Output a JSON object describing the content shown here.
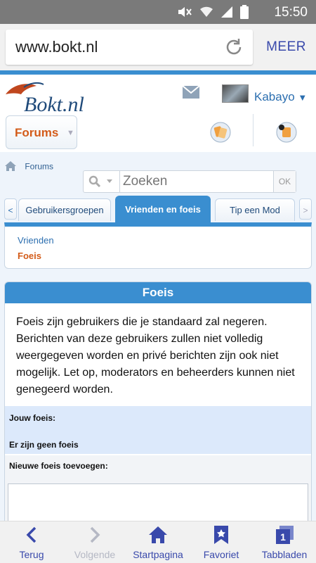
{
  "status_bar": {
    "time": "15:50"
  },
  "browser": {
    "url": "www.bokt.nl",
    "menu_label": "MEER"
  },
  "site": {
    "logo_text": "Bokt.nl",
    "user": {
      "name": "Kabayo",
      "caret": "▼"
    },
    "forums_button": {
      "label": "Forums",
      "caret": "▼"
    },
    "breadcrumb": {
      "label": "Forums"
    },
    "search": {
      "placeholder": "Zoeken",
      "submit": "OK"
    },
    "tabs": {
      "prev": "<",
      "next": ">",
      "items": [
        {
          "label": "Gebruikersgroepen",
          "active": false
        },
        {
          "label": "Vrienden en foeis",
          "active": true
        },
        {
          "label": "Tip een Mod",
          "active": false
        }
      ]
    },
    "sub_nav": {
      "friends": "Vrienden",
      "foes": "Foeis"
    },
    "panel": {
      "title": "Foeis",
      "description": "Foeis zijn gebruikers die je standaard zal negeren. Berichten van deze gebruikers zullen niet volledig weergegeven worden en privé berichten zijn ook niet mogelijk. Let op, moderators en beheerders kunnen niet genegeerd worden.",
      "your_foes_label": "Jouw foeis:",
      "no_foes_text": "Er zijn geen foeis",
      "add_foes_label": "Nieuwe foeis toevoegen:"
    }
  },
  "bottom_nav": {
    "back": "Terug",
    "forward": "Volgende",
    "home": "Startpagina",
    "favorites": "Favoriet",
    "tabs": "Tabbladen",
    "tab_count": "1"
  },
  "colors": {
    "accent": "#3a8ed0",
    "link": "#2c6fb0",
    "orange": "#d35b19",
    "nav": "#3949ab"
  }
}
